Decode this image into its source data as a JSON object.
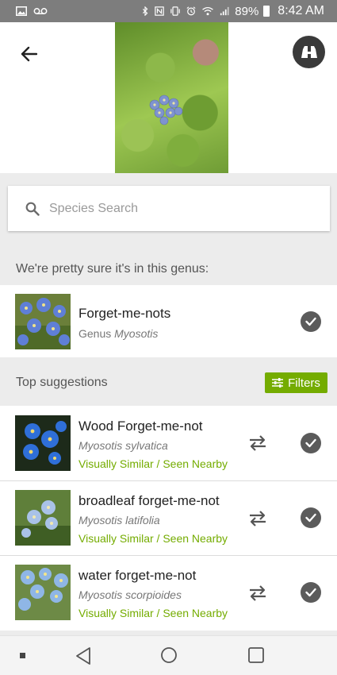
{
  "status_bar": {
    "battery": "89%",
    "time": "8:42 AM"
  },
  "search": {
    "placeholder": "Species Search"
  },
  "genus_section": {
    "label": "We're pretty sure it's in this genus:",
    "name": "Forget-me-nots",
    "rank": "Genus",
    "scientific": "Myosotis"
  },
  "suggestions": {
    "label": "Top suggestions",
    "filters_label": "Filters",
    "items": [
      {
        "common": "Wood Forget-me-not",
        "scientific": "Myosotis sylvatica",
        "reason": "Visually Similar / Seen Nearby"
      },
      {
        "common": "broadleaf forget-me-not",
        "scientific": "Myosotis latifolia",
        "reason": "Visually Similar / Seen Nearby"
      },
      {
        "common": "water forget-me-not",
        "scientific": "Myosotis scorpioides",
        "reason": "Visually Similar / Seen Nearby"
      }
    ]
  },
  "colors": {
    "accent": "#74ac00",
    "statusbar": "#7d7d7d",
    "check": "#5b5b5b"
  },
  "icons": [
    "image-icon",
    "voicemail-icon",
    "bluetooth-icon",
    "nfc-icon",
    "vibrate-icon",
    "alarm-icon",
    "wifi-icon",
    "signal-icon",
    "battery-icon",
    "back-arrow-icon",
    "binoculars-icon",
    "search-icon",
    "check-icon",
    "filters-icon",
    "swap-icon",
    "nav-back-icon",
    "nav-home-icon",
    "nav-recents-icon"
  ]
}
